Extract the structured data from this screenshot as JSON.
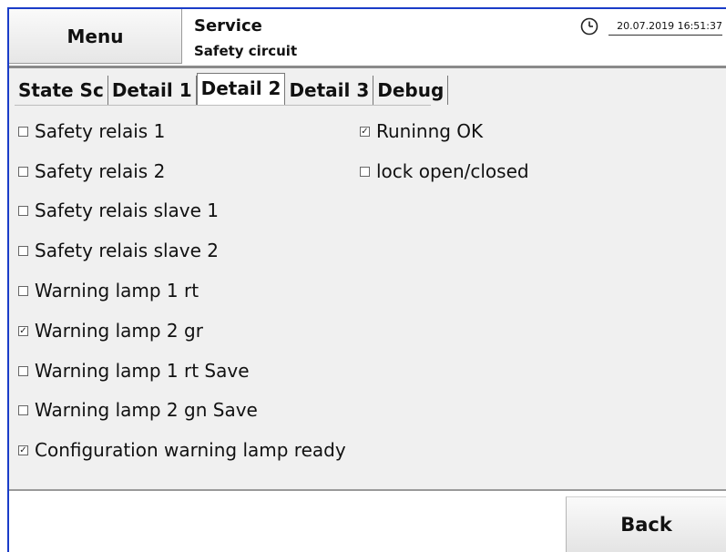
{
  "header": {
    "menu_label": "Menu",
    "title": "Service",
    "subtitle": "Safety circuit",
    "datetime": "20.07.2019   16:51:37",
    "clock_icon": "clock-icon"
  },
  "tabs": [
    {
      "label": "State Sc",
      "active": false
    },
    {
      "label": "Detail 1",
      "active": false
    },
    {
      "label": "Detail 2",
      "active": true
    },
    {
      "label": "Detail 3",
      "active": false
    },
    {
      "label": "Debug",
      "active": false
    }
  ],
  "left_items": [
    {
      "label": "Safety relais 1",
      "checked": false
    },
    {
      "label": "Safety relais 2",
      "checked": false
    },
    {
      "label": "Safety relais slave 1",
      "checked": false
    },
    {
      "label": "Safety relais slave 2",
      "checked": false
    },
    {
      "label": "Warning lamp 1 rt",
      "checked": false
    },
    {
      "label": "Warning lamp 2 gr",
      "checked": true
    },
    {
      "label": "Warning lamp 1 rt Save",
      "checked": false
    },
    {
      "label": "Warning lamp 2 gn Save",
      "checked": false
    },
    {
      "label": "Configuration warning lamp ready",
      "checked": true
    }
  ],
  "right_items": [
    {
      "label": "Runinng OK",
      "checked": true
    },
    {
      "label": "lock open/closed",
      "checked": false
    }
  ],
  "footer": {
    "back_label": "Back"
  },
  "colors": {
    "frame_accent": "#1a3cc8",
    "panel_bg": "#f0f0f0"
  }
}
